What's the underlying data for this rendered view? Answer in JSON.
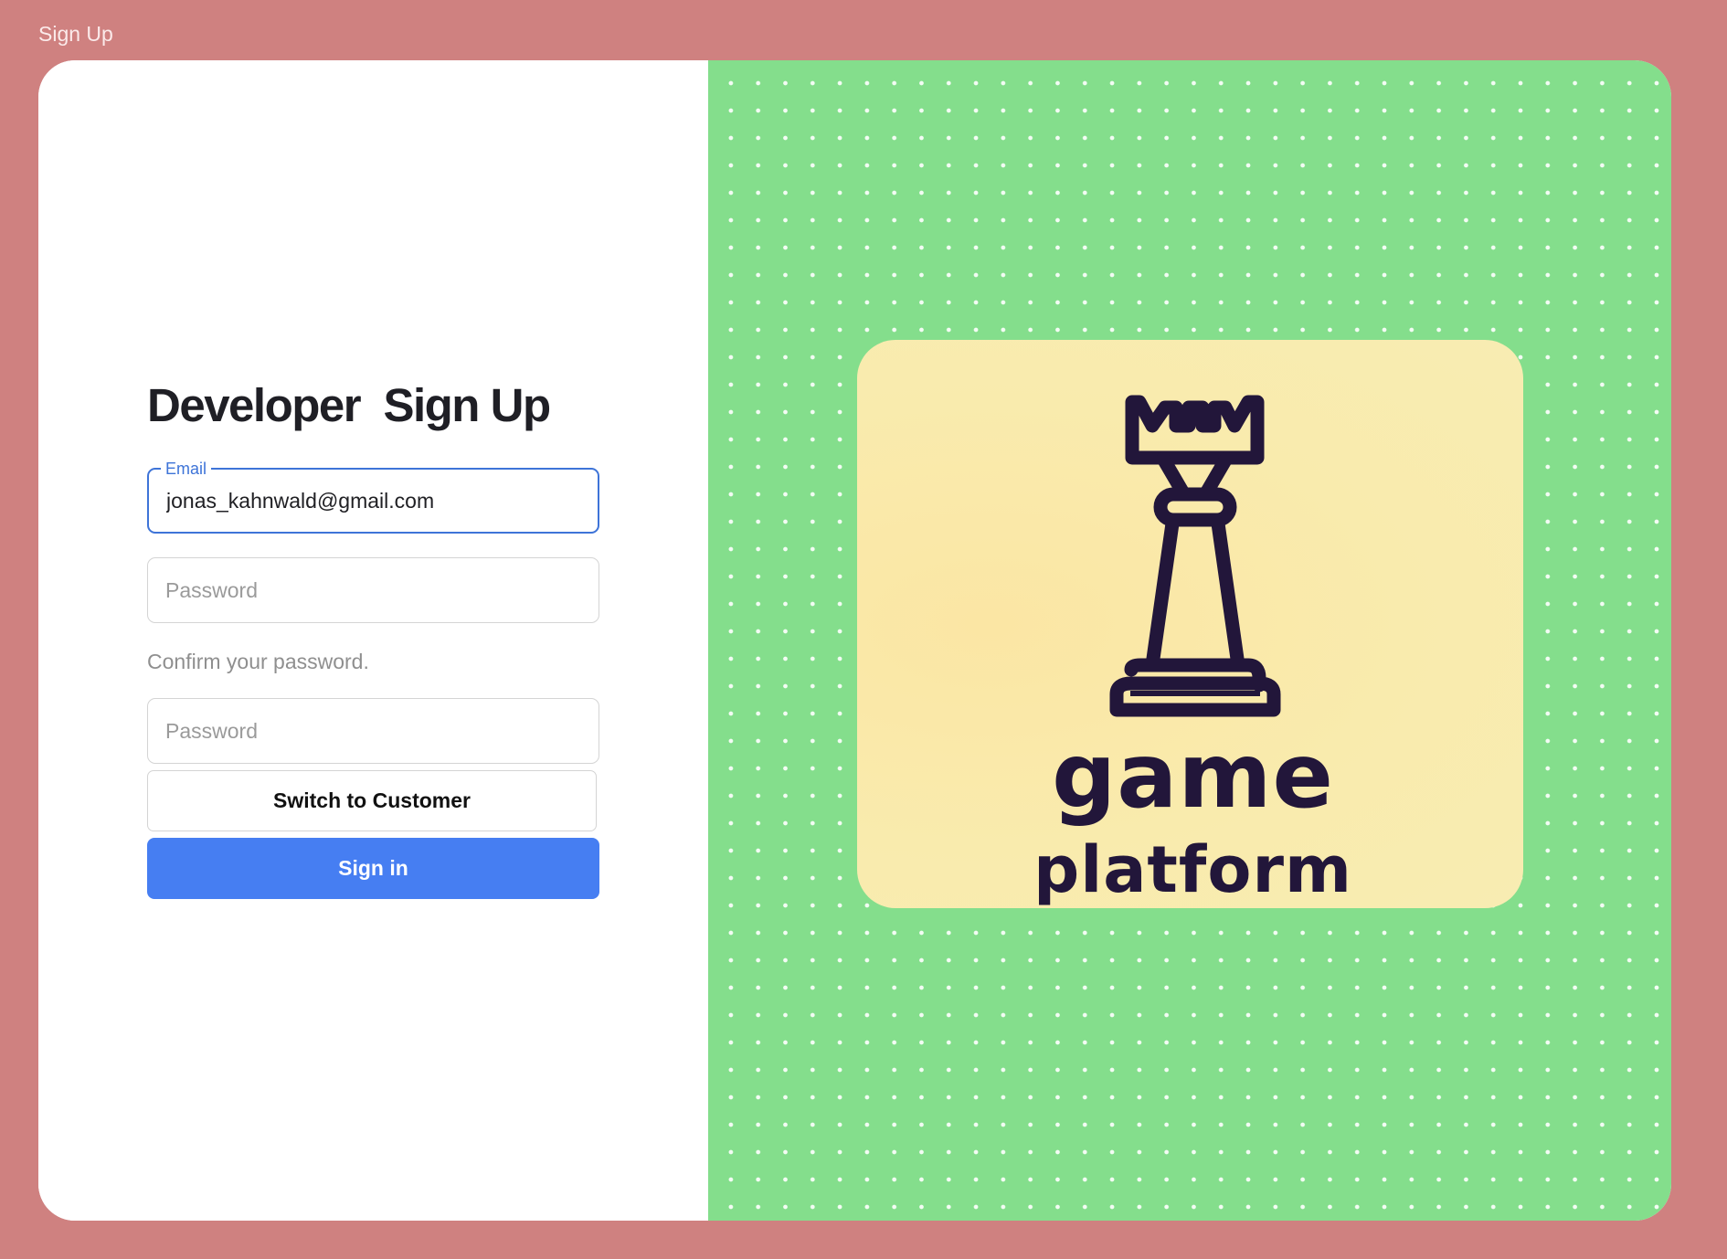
{
  "window": {
    "title": "Sign Up"
  },
  "form": {
    "heading": "Developer  Sign Up",
    "email": {
      "label": "Email",
      "value": "jonas_kahnwald@gmail.com"
    },
    "password": {
      "placeholder": "Password"
    },
    "confirm_helper": "Confirm your password.",
    "confirm_password": {
      "placeholder": "Password"
    },
    "switch_button": "Switch to Customer",
    "submit_button": "Sign in"
  },
  "logo": {
    "icon": "chess-rook-icon",
    "line1": "game",
    "line2": "platform"
  },
  "colors": {
    "background": "#cf8180",
    "panel_green": "#84de8c",
    "logo_card": "#f9ebad",
    "logo_ink": "#22163a",
    "primary": "#467ef2",
    "focus": "#3e74d8"
  }
}
